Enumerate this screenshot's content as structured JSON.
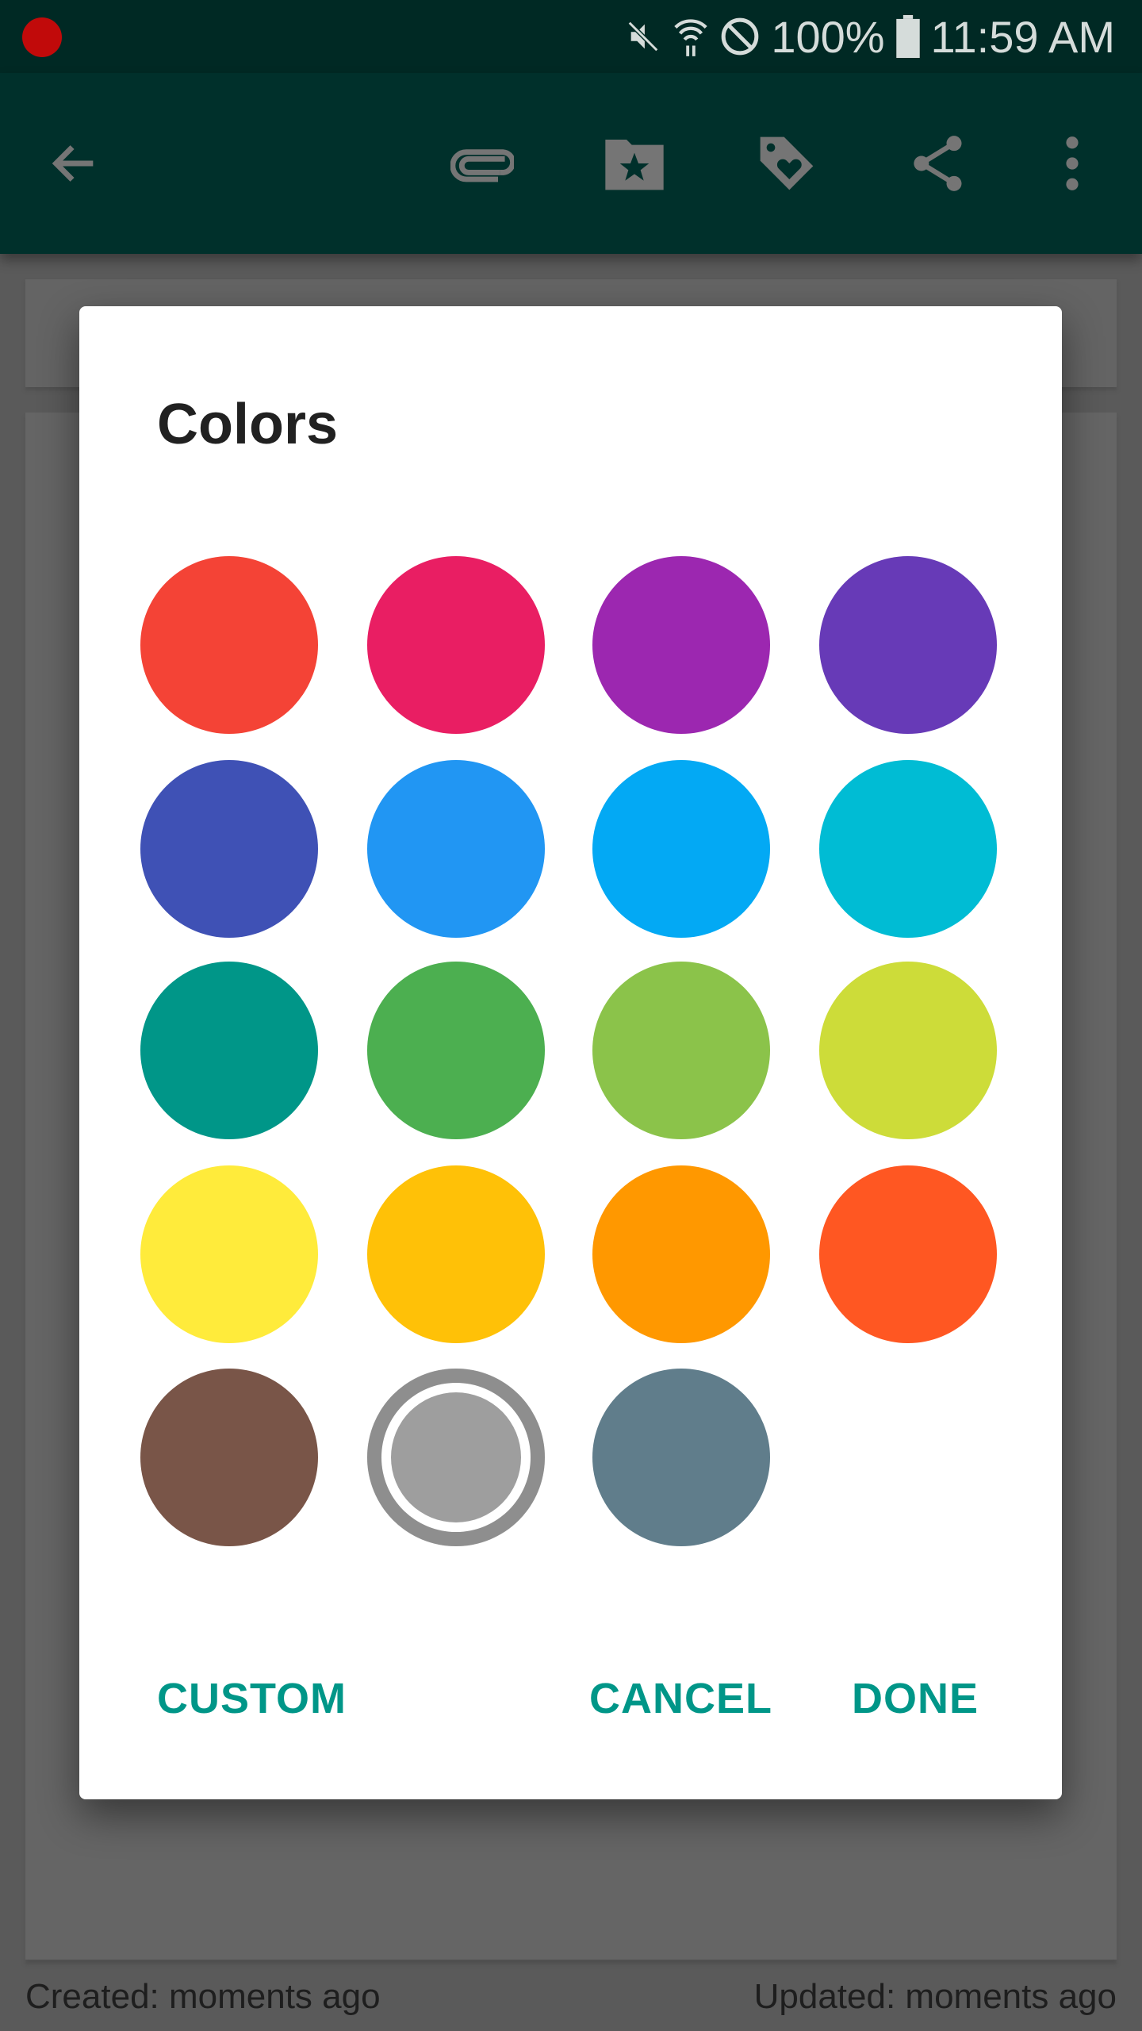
{
  "status_bar": {
    "battery": "100%",
    "time": "11:59 AM",
    "icons": [
      "record-dot-icon",
      "mute-icon",
      "wifi-icon",
      "do-not-disturb-icon",
      "battery-icon"
    ]
  },
  "toolbar": {
    "icons": [
      "back-arrow-icon",
      "attachment-icon",
      "folder-star-icon",
      "tag-heart-icon",
      "share-icon",
      "more-vert-icon"
    ]
  },
  "dialog": {
    "title": "Colors",
    "swatches": [
      {
        "name": "red",
        "color": "#F44336"
      },
      {
        "name": "pink",
        "color": "#E91E63"
      },
      {
        "name": "purple",
        "color": "#9C27B0"
      },
      {
        "name": "deep-purple",
        "color": "#673AB7"
      },
      {
        "name": "indigo",
        "color": "#3F51B5"
      },
      {
        "name": "blue",
        "color": "#2196F3"
      },
      {
        "name": "light-blue",
        "color": "#03A9F4"
      },
      {
        "name": "cyan",
        "color": "#00BCD4"
      },
      {
        "name": "teal",
        "color": "#009688"
      },
      {
        "name": "green",
        "color": "#4CAF50"
      },
      {
        "name": "light-green",
        "color": "#8BC34A"
      },
      {
        "name": "lime",
        "color": "#CDDC39"
      },
      {
        "name": "yellow",
        "color": "#FFEB3B"
      },
      {
        "name": "amber",
        "color": "#FFC107"
      },
      {
        "name": "orange",
        "color": "#FF9800"
      },
      {
        "name": "deep-orange",
        "color": "#FF5722"
      },
      {
        "name": "brown",
        "color": "#795548"
      },
      {
        "name": "grey",
        "color": "#9E9E9E",
        "selected": true
      },
      {
        "name": "blue-grey",
        "color": "#607D8B"
      }
    ],
    "buttons": {
      "custom": "CUSTOM",
      "cancel": "CANCEL",
      "done": "DONE"
    },
    "accent": "#009688"
  },
  "footer": {
    "created": "Created: moments ago",
    "updated": "Updated: moments ago"
  }
}
